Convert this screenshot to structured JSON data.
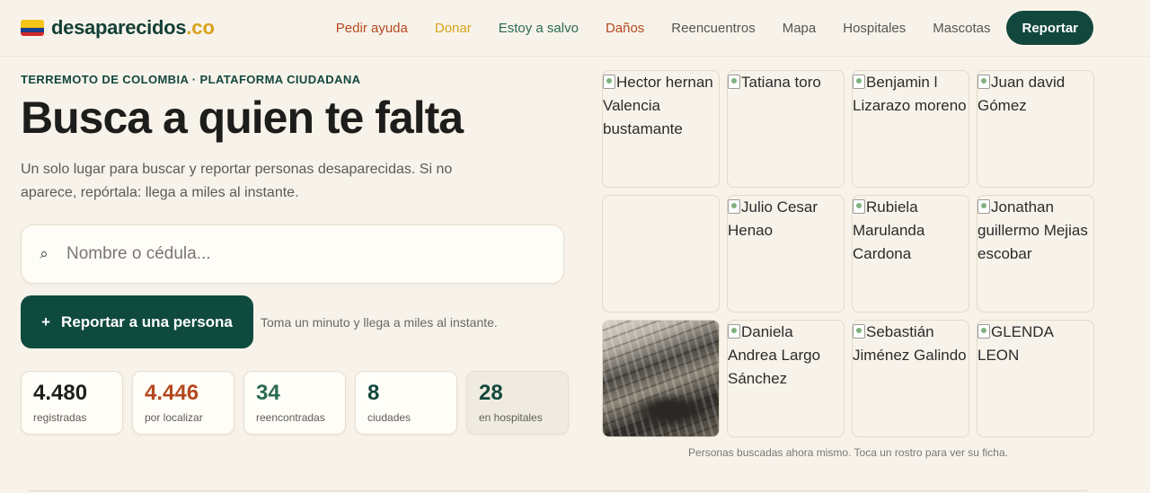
{
  "brand": {
    "name": "desaparecidos",
    "tld": ".co"
  },
  "nav": {
    "items": [
      "Pedir ayuda",
      "Donar",
      "Estoy a salvo",
      "Daños",
      "Reencuentros",
      "Mapa",
      "Hospitales",
      "Mascotas"
    ],
    "cta": "Reportar"
  },
  "hero": {
    "eyebrow": "TERREMOTO DE COLOMBIA · PLATAFORMA CIUDADANA",
    "title": "Busca a quien te falta",
    "subtitle": "Un solo lugar para buscar y reportar personas desaparecidas. Si no aparece, repórtala: llega a miles al instante."
  },
  "search": {
    "placeholder": "Nombre o cédula...",
    "icon": "search-icon"
  },
  "report": {
    "label": "Reportar a una persona",
    "plus": "+",
    "note": "Toma un minuto y llega a miles al instante."
  },
  "stats": [
    {
      "value": "4.480",
      "label": "registradas",
      "color": "#1d1d1b"
    },
    {
      "value": "4.446",
      "label": "por localizar",
      "color": "#b5481f"
    },
    {
      "value": "34",
      "label": "reencontradas",
      "color": "#2a6a55"
    },
    {
      "value": "8",
      "label": "ciudades",
      "color": "#12473d"
    },
    {
      "value": "28",
      "label": "en hospitales",
      "color": "#12473d"
    }
  ],
  "people": [
    "Hector hernan Valencia bustamante",
    "Tatiana toro",
    "Benjamin l Lizarazo moreno",
    "Juan david Gómez",
    "",
    "Julio Cesar Henao",
    "Rubiela Marulanda Cardona",
    "Jonathan guillermo Mejias escobar",
    "",
    "Daniela Andrea Largo Sánchez",
    "Sebastián Jiménez Galindo",
    "GLENDA LEON"
  ],
  "grid_caption": "Personas buscadas ahora mismo. Toca un rostro para ver su ficha."
}
